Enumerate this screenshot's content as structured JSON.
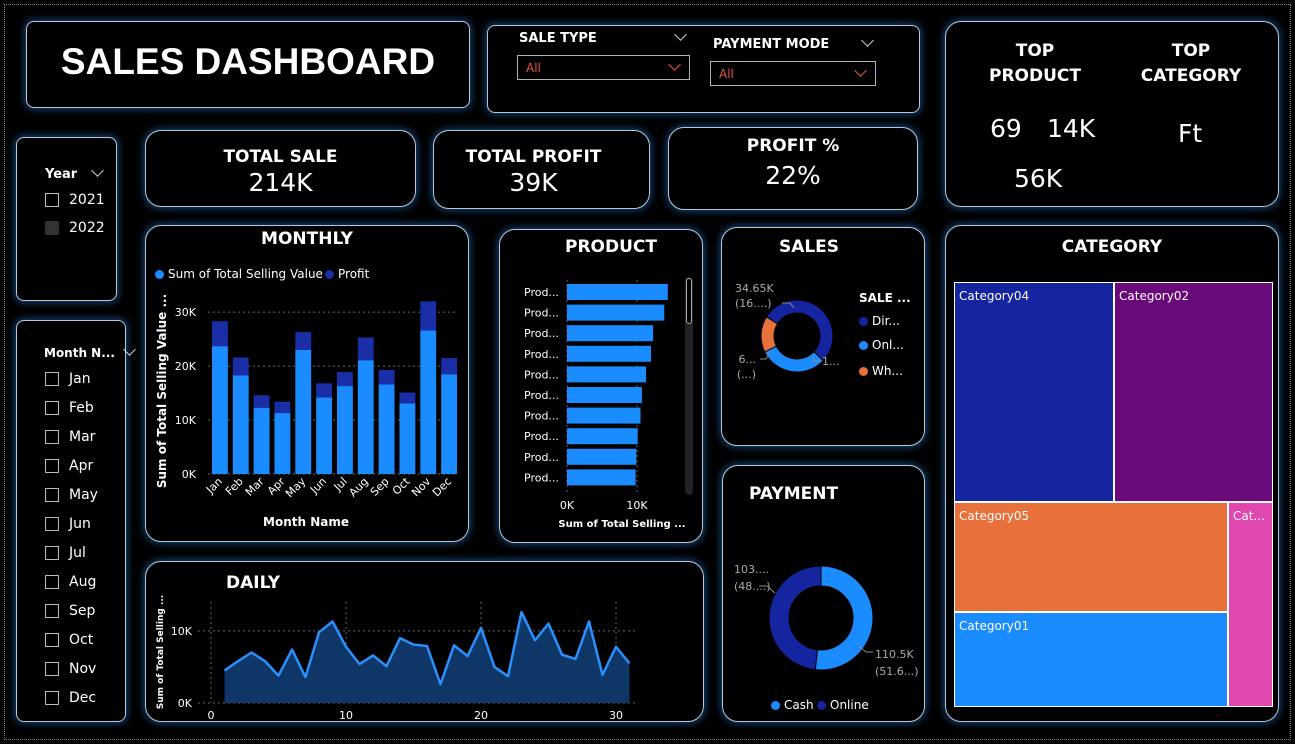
{
  "header": {
    "title": "SALES DASHBOARD"
  },
  "filters": {
    "sale_type": {
      "label": "SALE TYPE",
      "value": "All"
    },
    "payment_mode": {
      "label": "PAYMENT MODE",
      "value": "All"
    }
  },
  "top": {
    "product_label": "TOP PRODUCT",
    "category_label": "TOP CATEGORY",
    "product_values": [
      "69",
      "14K",
      "56K"
    ],
    "category_value": "Ft"
  },
  "kpis": {
    "total_sale": {
      "label": "TOTAL SALE",
      "value": "214K"
    },
    "total_profit": {
      "label": "TOTAL PROFIT",
      "value": "39K"
    },
    "profit_pct": {
      "label": "PROFIT %",
      "value": "22%"
    }
  },
  "year_slicer": {
    "label": "Year",
    "items": [
      {
        "label": "2021",
        "checked": false
      },
      {
        "label": "2022",
        "checked": true
      }
    ]
  },
  "month_slicer": {
    "label": "Month N...",
    "items": [
      "Jan",
      "Feb",
      "Mar",
      "Apr",
      "May",
      "Jun",
      "Jul",
      "Aug",
      "Sep",
      "Oct",
      "Nov",
      "Dec"
    ]
  },
  "colors": {
    "sales": "#1a8cff",
    "profit": "#1a2ea8",
    "orange": "#e8703a",
    "purple": "#6a0a7a",
    "pink": "#e048b0",
    "navy": "#1525a0"
  },
  "chart_data": [
    {
      "type": "bar",
      "title": "MONTHLY",
      "xlabel": "Month Name",
      "ylabel": "Sum of Total Selling Value ...",
      "categories": [
        "Jan",
        "Feb",
        "Mar",
        "Apr",
        "May",
        "Jun",
        "Jul",
        "Aug",
        "Sep",
        "Oct",
        "Nov",
        "Dec"
      ],
      "series": [
        {
          "name": "Sum of Total Selling Value",
          "values": [
            23700,
            18300,
            12300,
            11300,
            23000,
            14200,
            16300,
            21100,
            16600,
            13100,
            26600,
            18500
          ]
        },
        {
          "name": "Profit",
          "values": [
            4600,
            3300,
            2300,
            2100,
            3300,
            2600,
            2600,
            4200,
            2700,
            2000,
            5400,
            3000
          ]
        }
      ],
      "yticks": [
        "0K",
        "10K",
        "20K",
        "30K"
      ],
      "ylim": [
        0,
        33000
      ],
      "legend": "top-left"
    },
    {
      "type": "bar",
      "orientation": "horizontal",
      "title": "PRODUCT",
      "xlabel": "Sum of Total Selling ...",
      "categories": [
        "Prod...",
        "Prod...",
        "Prod...",
        "Prod...",
        "Prod...",
        "Prod...",
        "Prod...",
        "Prod...",
        "Prod...",
        "Prod..."
      ],
      "values": [
        14400,
        13900,
        12300,
        12000,
        11300,
        10700,
        10500,
        10100,
        9900,
        9800
      ],
      "xticks": [
        "0K",
        "10K"
      ],
      "xlim": [
        0,
        15000
      ]
    },
    {
      "type": "pie",
      "title": "SALES",
      "legend_title": "SALE ...",
      "labels": [
        "Dir...",
        "Onl...",
        "Wh..."
      ],
      "values": [
        114000,
        66000,
        34650
      ],
      "data_labels": [
        "1...",
        "6...\n(...)",
        "34.65K\n(16....)"
      ]
    },
    {
      "type": "pie",
      "title": "PAYMENT",
      "labels": [
        "Cash",
        "Online"
      ],
      "values": [
        103000,
        110500
      ],
      "data_labels": [
        "103....\n(48....)",
        "110.5K\n(51.6...)"
      ]
    },
    {
      "type": "area",
      "title": "DAILY",
      "ylabel": "Sum of Total Selling ...",
      "x": [
        1,
        2,
        3,
        4,
        5,
        6,
        7,
        8,
        9,
        10,
        11,
        12,
        13,
        14,
        15,
        16,
        17,
        18,
        19,
        20,
        21,
        22,
        23,
        24,
        25,
        26,
        27,
        28,
        29,
        30,
        31
      ],
      "values": [
        4500,
        5800,
        7000,
        5800,
        3800,
        7400,
        3600,
        9800,
        11300,
        7800,
        5400,
        6600,
        5100,
        9000,
        8100,
        7900,
        2600,
        8000,
        6500,
        10400,
        5000,
        3700,
        12600,
        8700,
        11000,
        6700,
        6100,
        11300,
        3900,
        7800,
        5500
      ],
      "xticks": [
        "0",
        "10",
        "20",
        "30"
      ],
      "yticks": [
        "0K",
        "10K"
      ],
      "ylim": [
        0,
        14000
      ]
    },
    {
      "type": "heatmap",
      "title": "CATEGORY",
      "labels": [
        "Category04",
        "Category02",
        "Category05",
        "Cat...",
        "Category01"
      ]
    }
  ]
}
